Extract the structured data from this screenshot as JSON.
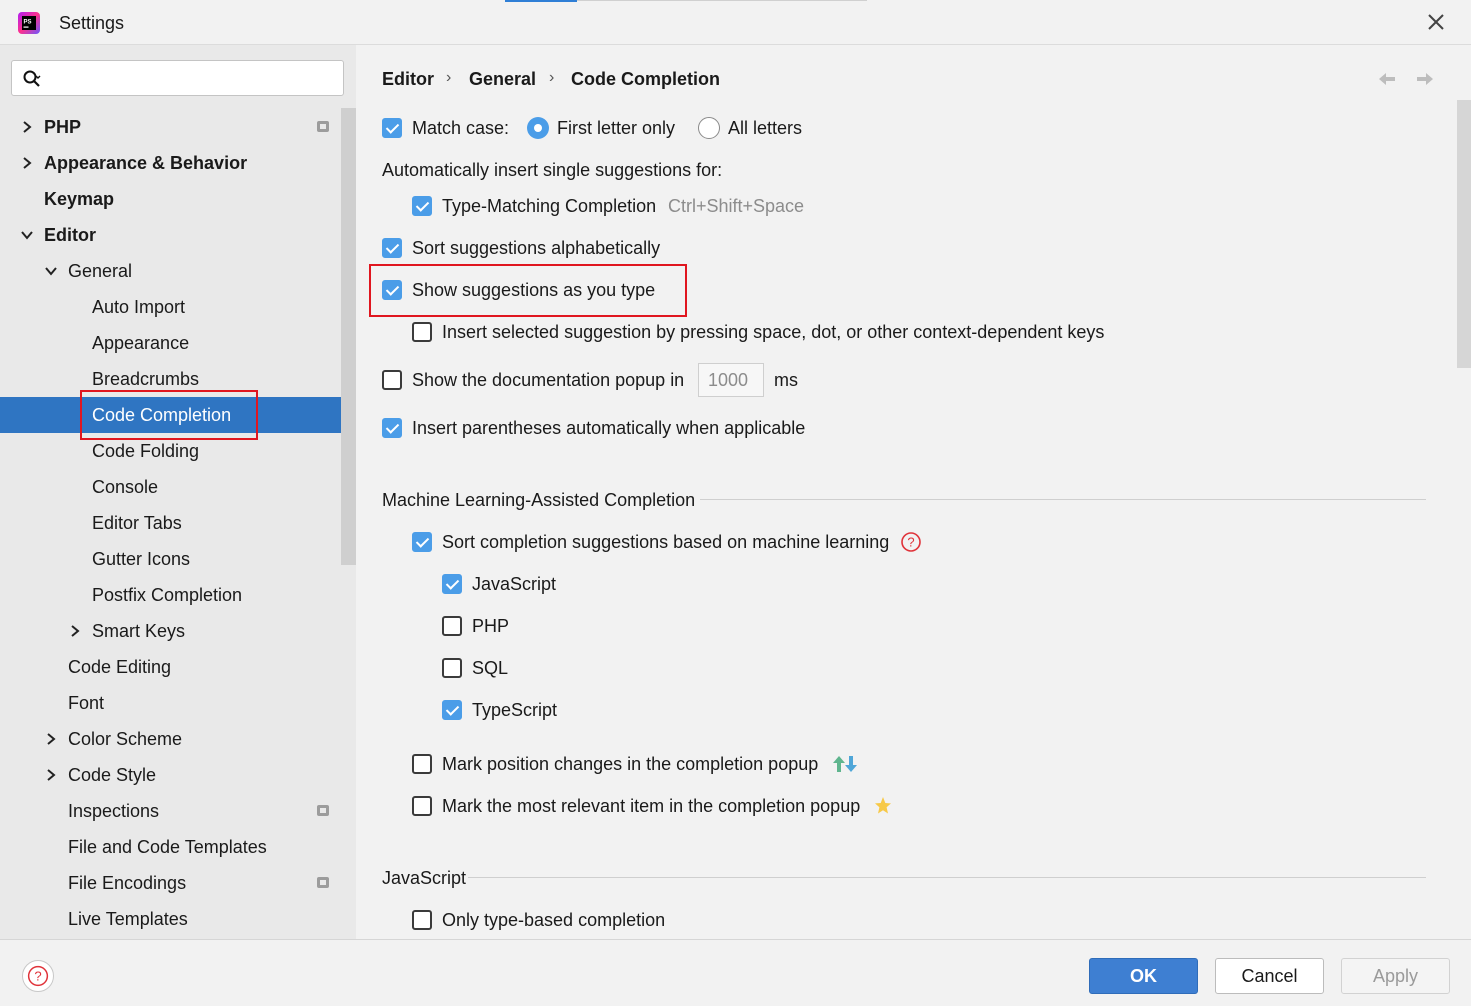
{
  "window": {
    "title": "Settings",
    "app_icon_text": "PS"
  },
  "search": {
    "placeholder": "",
    "value": ""
  },
  "sidebar": {
    "items": [
      {
        "label": "PHP"
      },
      {
        "label": "Appearance & Behavior"
      },
      {
        "label": "Keymap"
      },
      {
        "label": "Editor"
      },
      {
        "label": "General"
      },
      {
        "label": "Auto Import"
      },
      {
        "label": "Appearance"
      },
      {
        "label": "Breadcrumbs"
      },
      {
        "label": "Code Completion"
      },
      {
        "label": "Code Folding"
      },
      {
        "label": "Console"
      },
      {
        "label": "Editor Tabs"
      },
      {
        "label": "Gutter Icons"
      },
      {
        "label": "Postfix Completion"
      },
      {
        "label": "Smart Keys"
      },
      {
        "label": "Code Editing"
      },
      {
        "label": "Font"
      },
      {
        "label": "Color Scheme"
      },
      {
        "label": "Code Style"
      },
      {
        "label": "Inspections"
      },
      {
        "label": "File and Code Templates"
      },
      {
        "label": "File Encodings"
      },
      {
        "label": "Live Templates"
      }
    ]
  },
  "breadcrumb": {
    "items": [
      "Editor",
      "General",
      "Code Completion"
    ]
  },
  "options": {
    "match_case": "Match case:",
    "first_letter_only": "First letter only",
    "all_letters": "All letters",
    "auto_insert_heading": "Automatically insert single suggestions for:",
    "type_matching": "Type-Matching Completion",
    "type_matching_shortcut": "Ctrl+Shift+Space",
    "sort_alpha": "Sort suggestions alphabetically",
    "show_as_you_type": "Show suggestions as you type",
    "insert_selected": "Insert selected suggestion by pressing space, dot, or other context-dependent keys",
    "show_doc_popup": "Show the documentation popup in",
    "doc_popup_delay": "1000",
    "doc_popup_unit": "ms",
    "insert_parens": "Insert parentheses automatically when applicable"
  },
  "ml_section": {
    "title": "Machine Learning-Assisted Completion",
    "sort_ml": "Sort completion suggestions based on machine learning",
    "languages": [
      "JavaScript",
      "PHP",
      "SQL",
      "TypeScript"
    ],
    "mark_position": "Mark position changes in the completion popup",
    "mark_relevant": "Mark the most relevant item in the completion popup"
  },
  "js_section": {
    "title": "JavaScript",
    "only_type_based": "Only type-based completion"
  },
  "footer": {
    "ok": "OK",
    "cancel": "Cancel",
    "apply": "Apply"
  },
  "colors": {
    "accent": "#2f75c2",
    "checkbox_on": "#4b9de8",
    "highlight_box": "#e0161f",
    "ok_button": "#3e7fd2"
  }
}
